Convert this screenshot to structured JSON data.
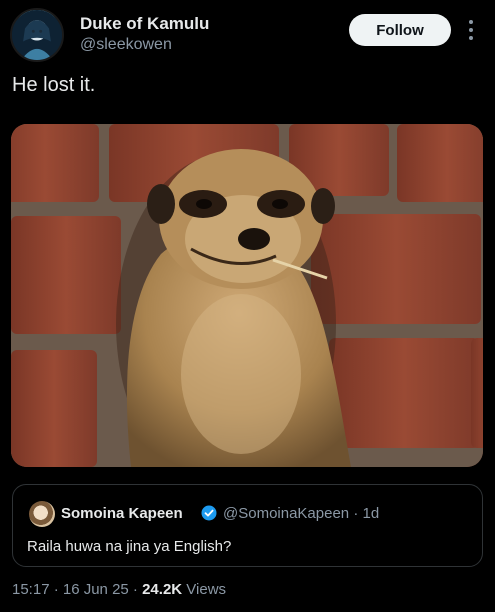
{
  "author": {
    "display_name": "Duke of Kamulu",
    "handle": "@sleekowen",
    "avatar": "anime-avatar"
  },
  "follow_button": {
    "label": "Follow"
  },
  "more_menu": {
    "icon": "more-vertical-icon"
  },
  "tweet": {
    "text": "He lost it."
  },
  "media": {
    "description_icon": "meerkat-photo",
    "colors": {
      "brick": "#8a3e2c",
      "mortar": "#6b5a4c",
      "fur": "#b8925e"
    }
  },
  "quoted_tweet": {
    "display_name": "Somoina Kapeen",
    "verified_icon": "verified-badge-icon",
    "handle_time": "@SomoinaKapeen · 1d",
    "text": "Raila huwa na jina ya English?"
  },
  "meta": {
    "timestamp": "15:17 · 16 Jun 25 · ",
    "views_count": "24.2K",
    "views_label": " Views"
  },
  "colors": {
    "background": "#000000",
    "text": "#e7e9ea",
    "secondary": "#8b98a5",
    "verified": "#1d9bf0",
    "follow_bg": "#eff3f4"
  }
}
